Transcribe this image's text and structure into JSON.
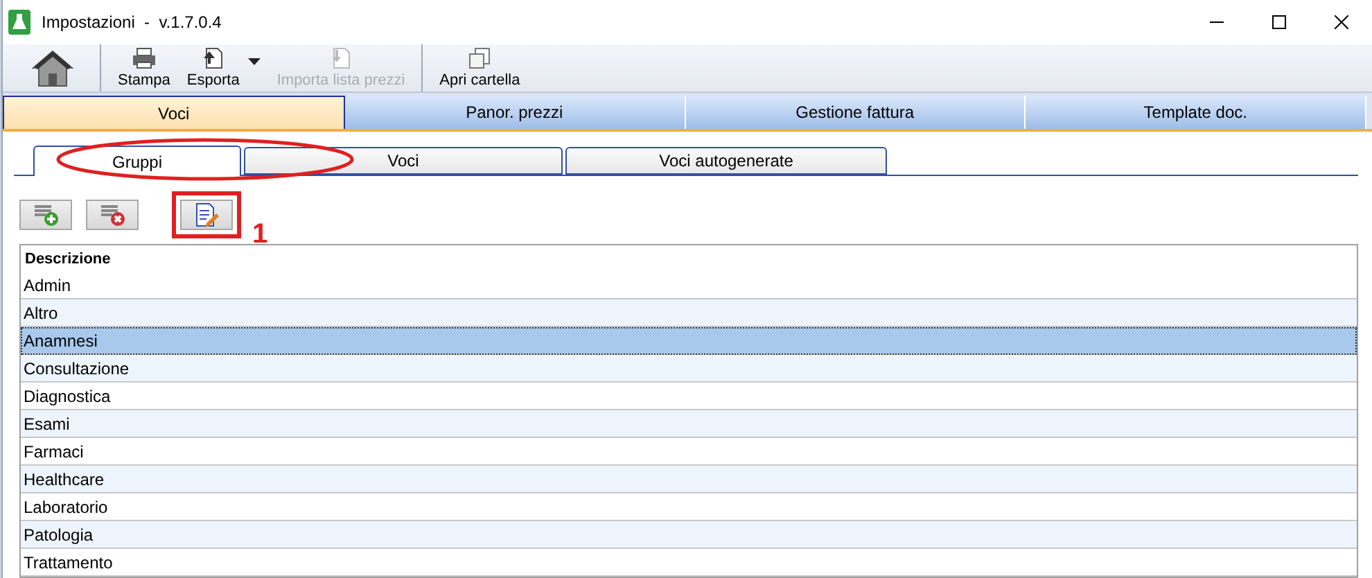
{
  "window": {
    "title": "Impostazioni  -  v.1.7.0.4"
  },
  "toolbar": [
    {
      "kind": "home"
    },
    {
      "kind": "print",
      "label": "Stampa",
      "disabled": false
    },
    {
      "kind": "export",
      "label": "Esporta",
      "disabled": false
    },
    {
      "kind": "import",
      "label": "Importa lista prezzi",
      "disabled": true
    },
    {
      "kind": "folder",
      "label": "Apri cartella",
      "disabled": false
    }
  ],
  "tabs": [
    {
      "label": "Voci",
      "selected": true
    },
    {
      "label": "Panor. prezzi",
      "selected": false
    },
    {
      "label": "Gestione fattura",
      "selected": false
    },
    {
      "label": "Template doc.",
      "selected": false
    }
  ],
  "subtabs": [
    {
      "label": "Gruppi",
      "selected": true
    },
    {
      "label": "Voci",
      "selected": false
    },
    {
      "label": "Voci autogenerate",
      "selected": false
    }
  ],
  "actions": [
    {
      "kind": "add"
    },
    {
      "kind": "delete"
    },
    {
      "kind": "edit"
    }
  ],
  "annotation": {
    "label": "1"
  },
  "table": {
    "columns": [
      "Descrizione"
    ],
    "rows": [
      {
        "cell": "Admin",
        "selected": false
      },
      {
        "cell": "Altro",
        "selected": false
      },
      {
        "cell": "Anamnesi",
        "selected": true
      },
      {
        "cell": "Consultazione",
        "selected": false
      },
      {
        "cell": "Diagnostica",
        "selected": false
      },
      {
        "cell": "Esami",
        "selected": false
      },
      {
        "cell": "Farmaci",
        "selected": false
      },
      {
        "cell": "Healthcare",
        "selected": false
      },
      {
        "cell": "Laboratorio",
        "selected": false
      },
      {
        "cell": "Patologia",
        "selected": false
      },
      {
        "cell": "Trattamento",
        "selected": false
      }
    ]
  }
}
